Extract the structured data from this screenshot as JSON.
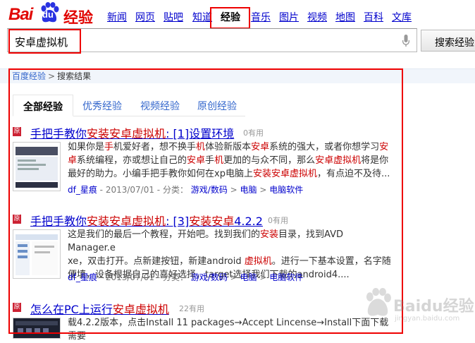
{
  "logo": {
    "text_bai": "Bai",
    "text_du": "du",
    "text_jy": "经验"
  },
  "nav": [
    "新闻",
    "网页",
    "贴吧",
    "知道",
    "经验",
    "音乐",
    "图片",
    "视频",
    "地图",
    "百科",
    "文库"
  ],
  "nav_active_index": 4,
  "search": {
    "value": "安卓虚拟机",
    "button_label": "搜索经验"
  },
  "breadcrumb": {
    "home": "百度经验",
    "separator": ">",
    "current": "搜索结果"
  },
  "tabs": [
    "全部经验",
    "优秀经验",
    "视频经验",
    "原创经验"
  ],
  "tabs_active_index": 0,
  "results": [
    {
      "badge": "原",
      "title_parts": [
        "手把手教你",
        "安装",
        "安卓",
        "虚拟机",
        ": [1]设置环境"
      ],
      "count": "0有用",
      "desc_lines": [
        [
          [
            "如果你是",
            0
          ],
          [
            "手",
            1
          ],
          [
            "机爱好者，想不换手",
            0
          ],
          [
            "机",
            1
          ],
          [
            "体验新版本",
            0
          ],
          [
            "安卓",
            1
          ],
          [
            "系统的强大，或者你想学习",
            0
          ],
          [
            "安",
            1
          ]
        ],
        [
          [
            "卓",
            1
          ],
          [
            "系统编程，亦或想让自己的",
            0
          ],
          [
            "安卓",
            1
          ],
          [
            "手",
            0
          ],
          [
            "机",
            1
          ],
          [
            "更加的与众不同，那么",
            0
          ],
          [
            "安卓虚拟机",
            1
          ],
          [
            "将是你",
            0
          ]
        ],
        [
          [
            "最好的助力。小编手把手教你如何在xp电脑上",
            0
          ],
          [
            "安装安卓虚拟机",
            1
          ],
          [
            "，有点迫不及待...",
            0
          ]
        ]
      ],
      "meta": {
        "author": "df_星痕",
        "date": "- 2013/07/01 - 分类：",
        "cats": [
          "游戏/数码",
          "电脑",
          "电脑软件"
        ]
      }
    },
    {
      "badge": "原",
      "title_parts": [
        "手把手教你",
        "安装",
        "安卓",
        "虚拟机",
        ": [3]",
        "安装安卓",
        "4.2.2"
      ],
      "count": "0有用",
      "desc_lines": [
        [
          [
            "这是我们的最后一个教程，开始吧。找到我们的",
            0
          ],
          [
            "安装",
            1
          ],
          [
            "目录，找到AVD Manager.e",
            0
          ]
        ],
        [
          [
            "xe，双击打开。点新建按钮，新建android ",
            0
          ],
          [
            "虚拟机",
            1
          ],
          [
            "。进行一下基本设置，名字随",
            0
          ]
        ],
        [
          [
            "便填，设备根据自己的喜好选择，target选择我们下载的android4....",
            0
          ]
        ]
      ],
      "meta": {
        "author": "df_星痕",
        "date": "- 2013/07/01 - 分类：",
        "cats": [
          "游戏/数码",
          "电脑",
          "电脑软件"
        ]
      }
    },
    {
      "badge": "原",
      "title_parts": [
        "怎么在PC上运行",
        "安卓虚拟机"
      ],
      "count": "22有用",
      "desc_lines": [
        [
          [
            "载4.2.2版本，点击Install 11 packages→Accept Lincense→Install下面下载需要",
            0
          ]
        ]
      ]
    }
  ],
  "watermark": {
    "text": "Baidu经验",
    "url": "jingyan.baidu.com"
  },
  "colors": {
    "brand_red": "#e10602",
    "link_blue": "#00c",
    "highlight_red": "#c00",
    "annotation_red": "#e00"
  }
}
